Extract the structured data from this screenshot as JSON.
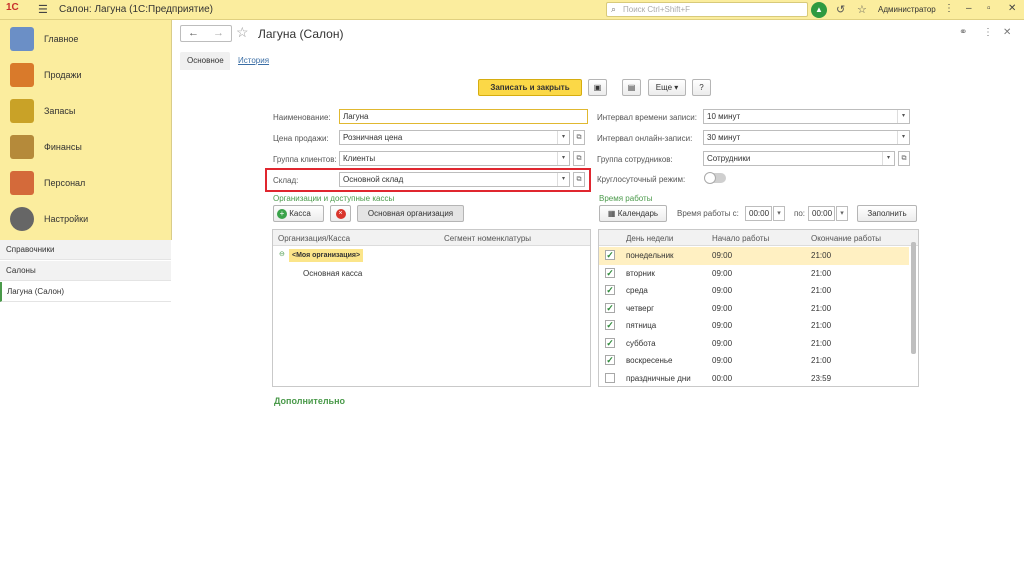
{
  "titlebar": {
    "logo": "1С",
    "app_title": "Салон: Лагуна  (1С:Предприятие)",
    "search_placeholder": "Поиск Ctrl+Shift+F",
    "user": "Администратор"
  },
  "sidebar": {
    "items": [
      {
        "label": "Главное",
        "color": "#6b8fc6"
      },
      {
        "label": "Продажи",
        "color": "#d97a2b"
      },
      {
        "label": "Запасы",
        "color": "#c9a227"
      },
      {
        "label": "Финансы",
        "color": "#b58a3a"
      },
      {
        "label": "Персонал",
        "color": "#d46a3a"
      },
      {
        "label": "Настройки",
        "color": "#666666"
      }
    ],
    "links": [
      "Справочники",
      "Салоны",
      "Лагуна (Салон)"
    ]
  },
  "header": {
    "title": "Лагуна (Салон)",
    "tabs": [
      "Основное",
      "История"
    ]
  },
  "toolbar": {
    "save_close": "Записать и закрыть",
    "more": "Еще",
    "help": "?"
  },
  "form": {
    "name_label": "Наименование:",
    "name_value": "Лагуна",
    "price_label": "Цена продажи:",
    "price_value": "Розничная цена",
    "group_label": "Группа клиентов:",
    "group_value": "Клиенты",
    "warehouse_label": "Склад:",
    "warehouse_value": "Основной склад",
    "interval_label": "Интервал времени записи:",
    "interval_value": "10 минут",
    "online_label": "Интервал онлайн-записи:",
    "online_value": "30 минут",
    "staff_label": "Группа сотрудников:",
    "staff_value": "Сотрудники",
    "roundclock_label": "Круглосуточный режим:"
  },
  "orgs": {
    "section_title": "Организации и доступные кассы",
    "add_kassa": "Касса",
    "main_org_btn": "Основная организация",
    "columns": [
      "Организация/Касса",
      "Сегмент номенклатуры"
    ],
    "org": "<Моя организация>",
    "kassa": "Основная касса"
  },
  "work": {
    "section_title": "Время работы",
    "calendar_btn": "Календарь",
    "time_label": "Время работы с:",
    "from": "00:00",
    "to_label": "по:",
    "to": "00:00",
    "fill_btn": "Заполнить",
    "columns": [
      "День недели",
      "Начало работы",
      "Окончание работы"
    ],
    "rows": [
      {
        "checked": true,
        "day": "понедельник",
        "start": "09:00",
        "end": "21:00"
      },
      {
        "checked": true,
        "day": "вторник",
        "start": "09:00",
        "end": "21:00"
      },
      {
        "checked": true,
        "day": "среда",
        "start": "09:00",
        "end": "21:00"
      },
      {
        "checked": true,
        "day": "четверг",
        "start": "09:00",
        "end": "21:00"
      },
      {
        "checked": true,
        "day": "пятница",
        "start": "09:00",
        "end": "21:00"
      },
      {
        "checked": true,
        "day": "суббота",
        "start": "09:00",
        "end": "21:00"
      },
      {
        "checked": true,
        "day": "воскресенье",
        "start": "09:00",
        "end": "21:00"
      },
      {
        "checked": false,
        "day": "праздничные дни",
        "start": "00:00",
        "end": "23:59"
      }
    ]
  },
  "extra": {
    "more_link": "Дополнительно"
  }
}
